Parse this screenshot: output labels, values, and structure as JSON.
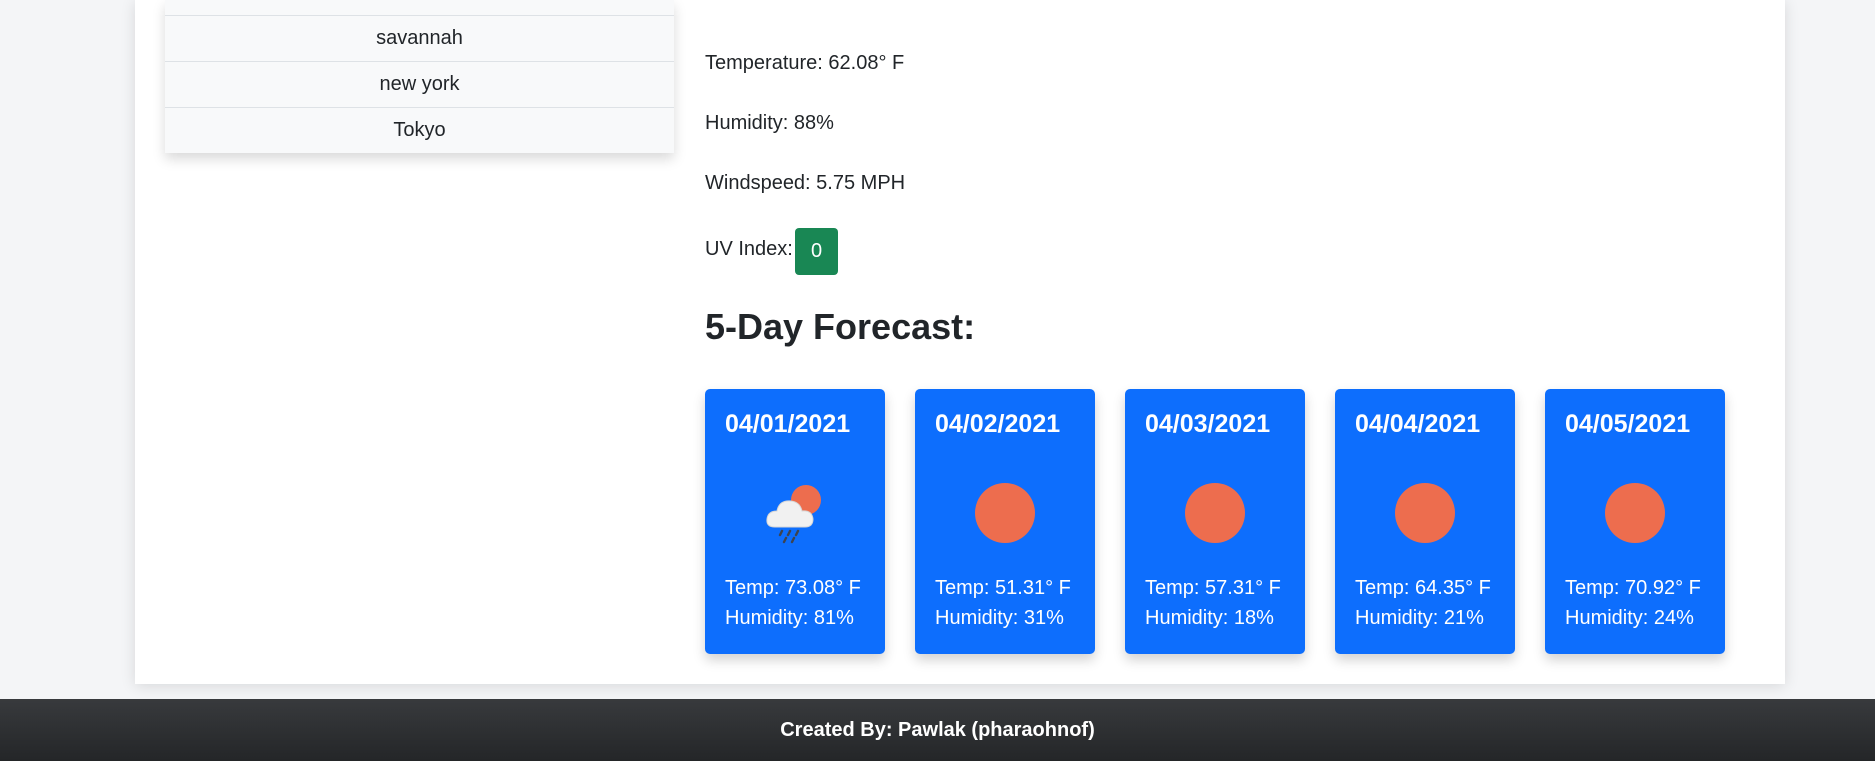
{
  "search_history": {
    "items": [
      {
        "label": ""
      },
      {
        "label": "savannah"
      },
      {
        "label": "new york"
      },
      {
        "label": "Tokyo"
      }
    ]
  },
  "current_weather": {
    "temperature_text": "Temperature: 62.08° F",
    "humidity_text": "Humidity: 88%",
    "windspeed_text": "Windspeed: 5.75 MPH",
    "uv_label": "UV Index:",
    "uv_value": "0",
    "uv_color": "#198754"
  },
  "forecast": {
    "title": "5-Day Forecast:",
    "card_color": "#0d6efd",
    "days": [
      {
        "date": "04/01/2021",
        "icon": "cloud-rain-sun-icon",
        "temp": "Temp: 73.08° F",
        "humidity": "Humidity: 81%"
      },
      {
        "date": "04/02/2021",
        "icon": "sun-icon",
        "temp": "Temp: 51.31° F",
        "humidity": "Humidity: 31%"
      },
      {
        "date": "04/03/2021",
        "icon": "sun-icon",
        "temp": "Temp: 57.31° F",
        "humidity": "Humidity: 18%"
      },
      {
        "date": "04/04/2021",
        "icon": "sun-icon",
        "temp": "Temp: 64.35° F",
        "humidity": "Humidity: 21%"
      },
      {
        "date": "04/05/2021",
        "icon": "sun-icon",
        "temp": "Temp: 70.92° F",
        "humidity": "Humidity: 24%"
      }
    ]
  },
  "footer": {
    "text": "Created By: Pawlak (pharaohnof)"
  }
}
